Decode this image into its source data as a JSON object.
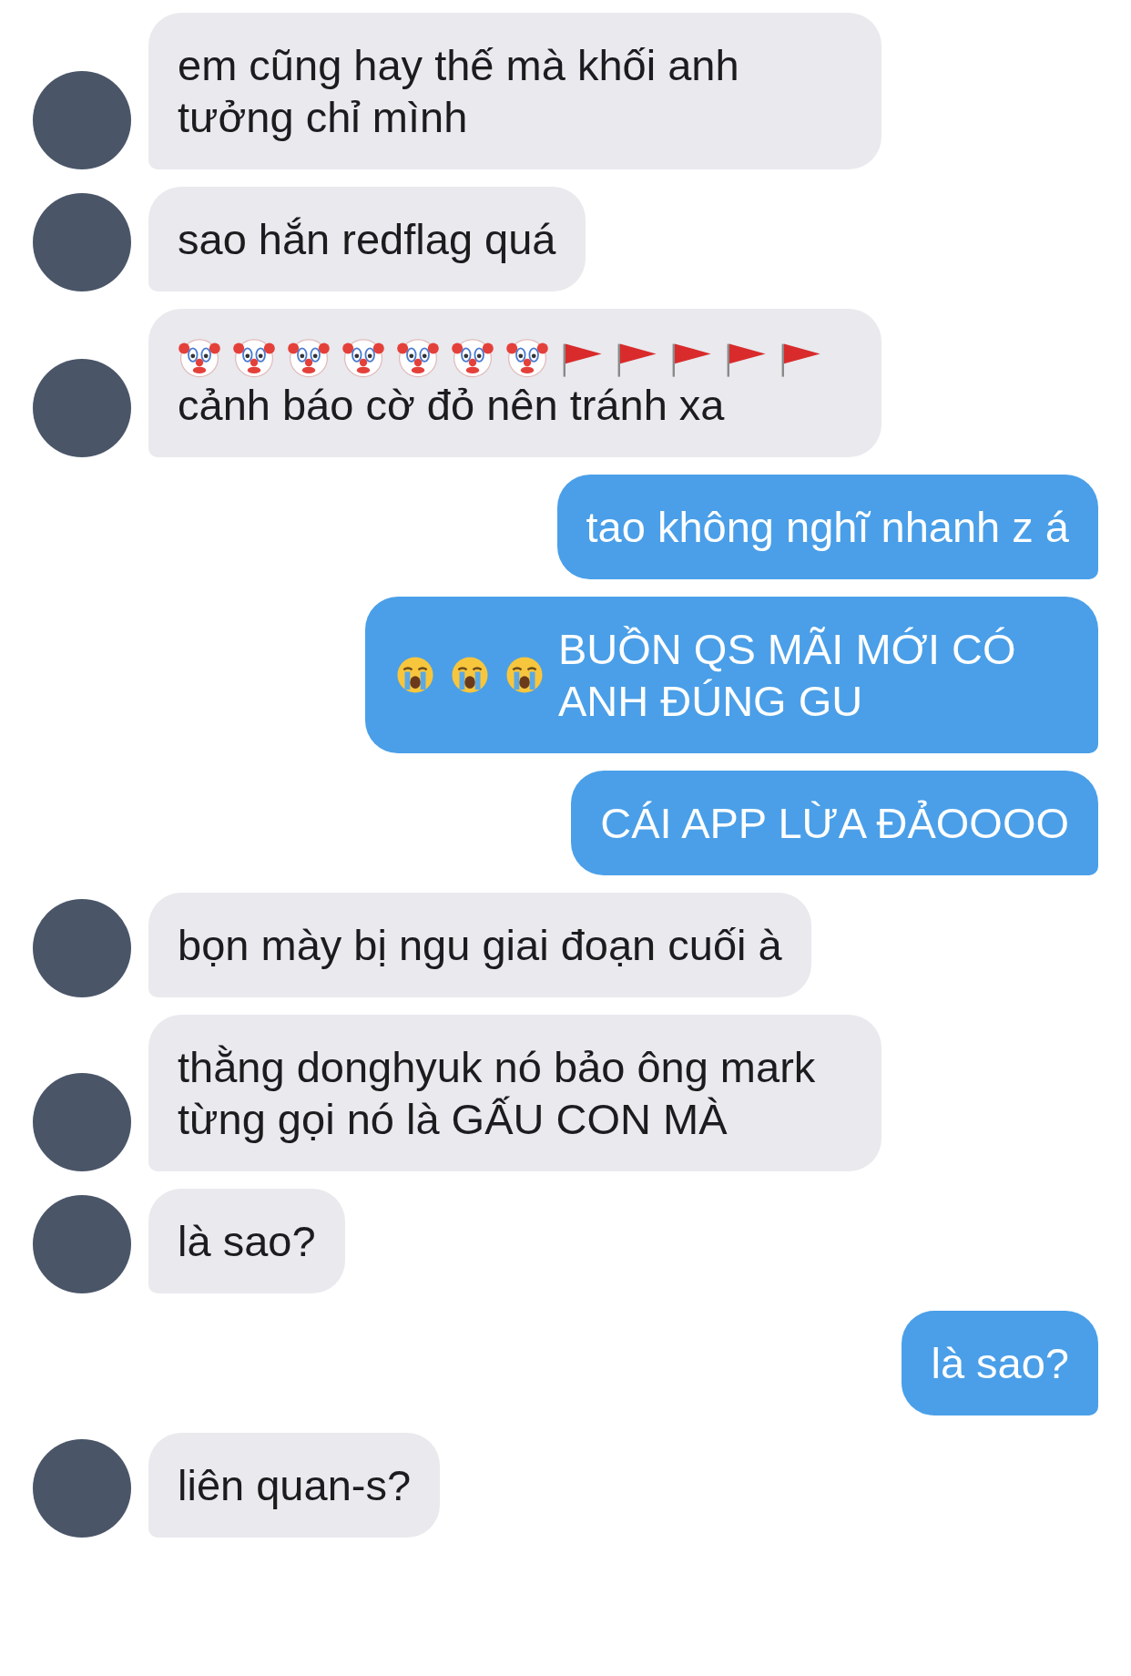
{
  "messages": [
    {
      "kind": "incoming",
      "text": "em cũng hay thế mà khối anh tưởng chỉ mình"
    },
    {
      "kind": "incoming",
      "text": "sao hắn redflag quá"
    },
    {
      "kind": "incoming",
      "emojis": [
        {
          "kind": "clown"
        },
        {
          "kind": "clown"
        },
        {
          "kind": "clown"
        },
        {
          "kind": "clown"
        },
        {
          "kind": "clown"
        },
        {
          "kind": "clown"
        },
        {
          "kind": "clown"
        },
        {
          "kind": "flag"
        },
        {
          "kind": "flag"
        },
        {
          "kind": "flag"
        },
        {
          "kind": "flag"
        },
        {
          "kind": "flag"
        }
      ],
      "text": "cảnh báo cờ đỏ nên tránh xa"
    },
    {
      "kind": "outgoing",
      "text": "tao không nghĩ nhanh z á"
    },
    {
      "kind": "outgoing",
      "emojis": [
        {
          "kind": "crying"
        },
        {
          "kind": "crying"
        },
        {
          "kind": "crying"
        }
      ],
      "text": "BUỒN QS MÃI MỚI CÓ ANH ĐÚNG GU"
    },
    {
      "kind": "outgoing",
      "text": "CÁI APP LỪA ĐẢOOOO"
    },
    {
      "kind": "incoming",
      "text": "bọn mày bị ngu giai đoạn cuối à"
    },
    {
      "kind": "incoming",
      "text": "thằng donghyuk nó bảo ông mark từng gọi nó là GẤU CON MÀ"
    },
    {
      "kind": "incoming",
      "text": "là sao?"
    },
    {
      "kind": "outgoing",
      "text": "là sao?"
    },
    {
      "kind": "incoming",
      "text": "liên quan-s?"
    }
  ]
}
